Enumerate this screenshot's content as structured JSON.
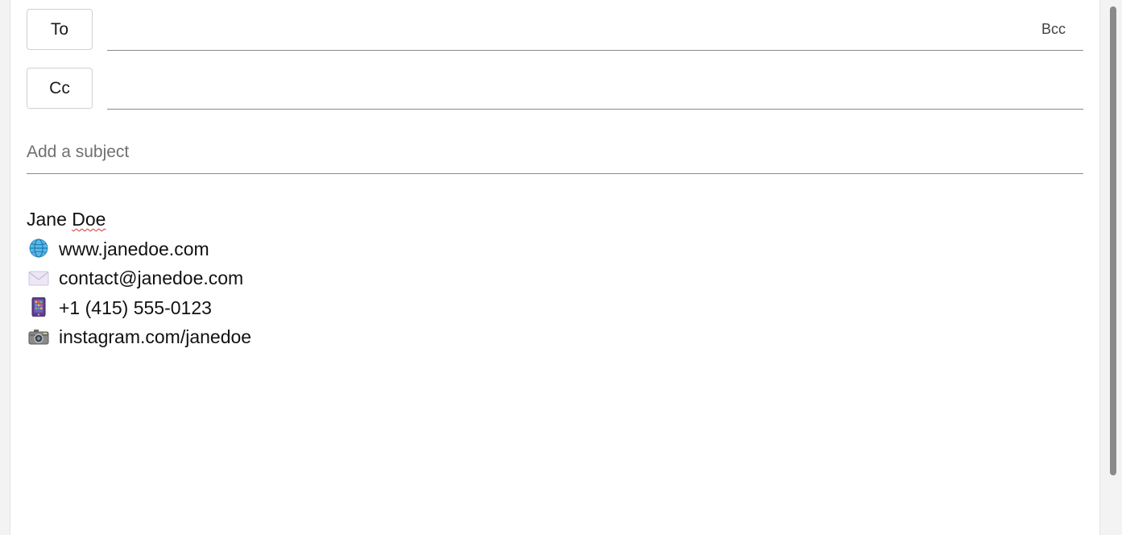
{
  "recipients": {
    "to_label": "To",
    "cc_label": "Cc",
    "bcc_label": "Bcc"
  },
  "subject": {
    "placeholder": "Add a subject"
  },
  "signature": {
    "name_first": "Jane",
    "name_last": "Doe",
    "lines": [
      {
        "icon": "globe-icon",
        "text": "www.janedoe.com"
      },
      {
        "icon": "envelope-icon",
        "text": "contact@janedoe.com"
      },
      {
        "icon": "mobile-phone-icon",
        "text": "+1 (415) 555-0123"
      },
      {
        "icon": "camera-icon",
        "text": "instagram.com/janedoe"
      }
    ]
  }
}
